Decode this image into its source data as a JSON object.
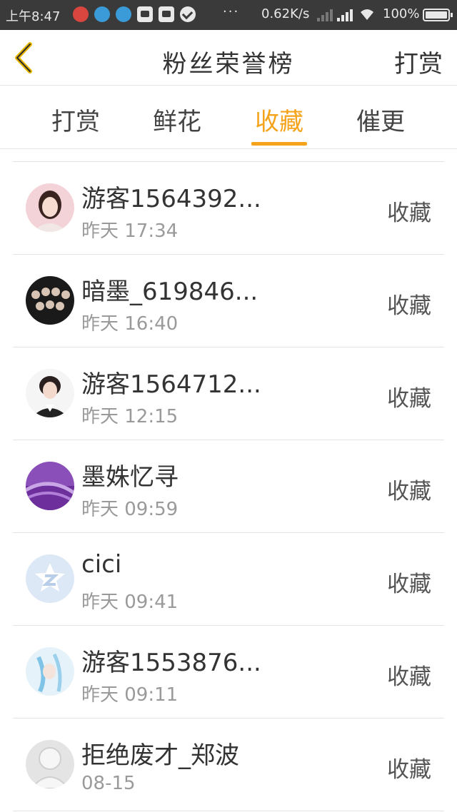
{
  "status_bar": {
    "time": "上午8:47",
    "ellipsis": "···",
    "net_speed": "0.62K/s",
    "battery": "100%"
  },
  "header": {
    "title": "粉丝荣誉榜",
    "action": "打赏"
  },
  "tabs": [
    {
      "label": "打赏",
      "active": false
    },
    {
      "label": "鲜花",
      "active": false
    },
    {
      "label": "收藏",
      "active": true
    },
    {
      "label": "催更",
      "active": false
    }
  ],
  "colors": {
    "accent": "#f5a31a",
    "status_bar_bg": "#3a3a3a"
  },
  "list": [
    {
      "name": "游客1564392...",
      "time": "昨天 17:34",
      "action": "收藏",
      "avatar": "girl-avatar"
    },
    {
      "name": "暗墨_619846...",
      "time": "昨天 16:40",
      "action": "收藏",
      "avatar": "group-avatar"
    },
    {
      "name": "游客1564712...",
      "time": "昨天 12:15",
      "action": "收藏",
      "avatar": "boy-avatar"
    },
    {
      "name": "墨姝忆寻",
      "time": "昨天 09:59",
      "action": "收藏",
      "avatar": "lavender-avatar"
    },
    {
      "name": "cici",
      "time": "昨天 09:41",
      "action": "收藏",
      "avatar": "qq-default-avatar"
    },
    {
      "name": "游客1553876...",
      "time": "昨天 09:11",
      "action": "收藏",
      "avatar": "anime-avatar"
    },
    {
      "name": "拒绝废才_郑波",
      "time": "08-15",
      "action": "收藏",
      "avatar": "default-person-avatar"
    }
  ]
}
